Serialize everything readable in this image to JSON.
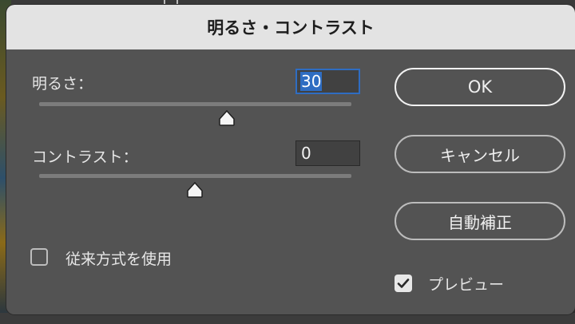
{
  "dialog": {
    "title": "明るさ・コントラスト"
  },
  "brightness": {
    "label": "明るさ：",
    "value": "30",
    "slider_fraction": 0.6
  },
  "contrast": {
    "label": "コントラスト：",
    "value": "0",
    "slider_fraction": 0.5
  },
  "buttons": {
    "ok": "OK",
    "cancel": "キャンセル",
    "auto": "自動補正"
  },
  "options": {
    "use_legacy_label": "従来方式を使用",
    "use_legacy_checked": false,
    "preview_label": "プレビュー",
    "preview_checked": true
  },
  "colors": {
    "dialog_bg": "#535353",
    "titlebar_bg": "#e3e3e3",
    "focus_blue": "#2f6dc2"
  }
}
